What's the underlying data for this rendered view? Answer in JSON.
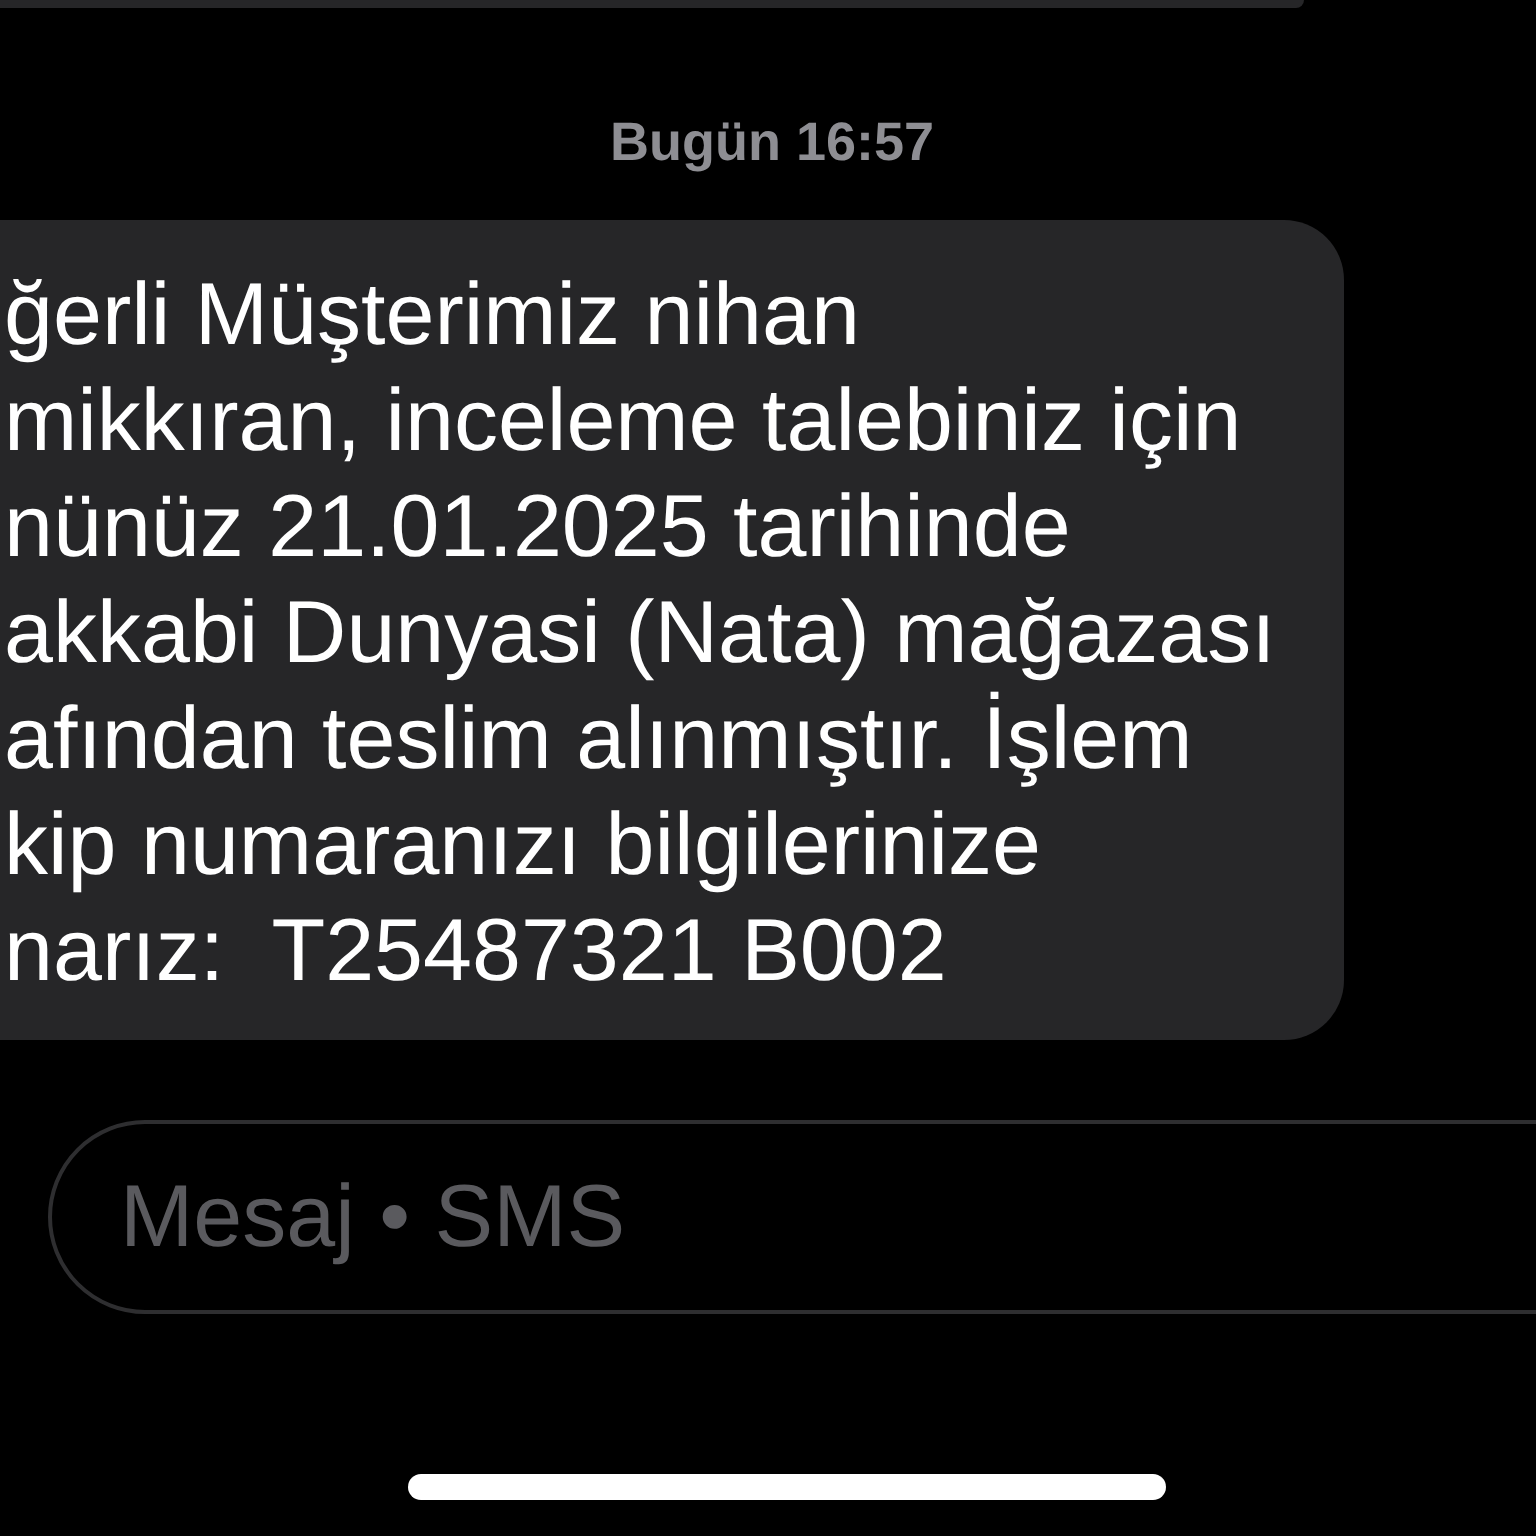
{
  "timestamp": "Bugün 16:57",
  "message": {
    "lines": [
      "ğerli Müşterimiz nihan",
      "mikkıran, inceleme talebiniz için",
      "nünüz 21.01.2025 tarihinde",
      "akkabi Dunyasi (Nata) mağazası",
      "afından teslim alınmıştır. İşlem",
      "kip numaranızı bilgilerinize",
      "narız:  T25487321 B002"
    ]
  },
  "composer": {
    "placeholder": "Mesaj • SMS"
  }
}
